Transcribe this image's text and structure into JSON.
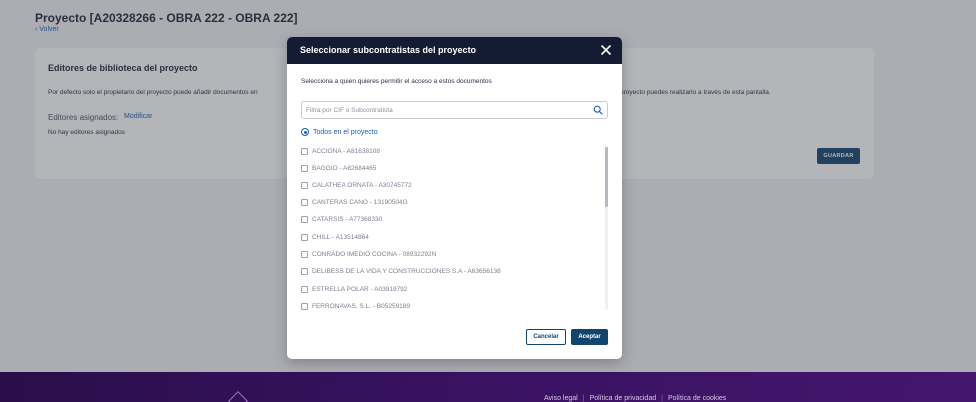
{
  "page": {
    "title": "Proyecto [A20328266 - OBRA 222 - OBRA 222]",
    "back_label": "‹ Volver"
  },
  "card": {
    "title": "Editores de biblioteca del proyecto",
    "description_left": "Por defecto solo el propietario del proyecto puede añadir documentos en",
    "description_right": "proyecto puedes realizarlo a través de esta pantalla.",
    "editors_label": "Editores asignados:",
    "modify_label": "Modificar",
    "empty_text": "No hay editores asignados",
    "save_label": "GUARDAR"
  },
  "modal": {
    "title": "Seleccionar subcontratistas del proyecto",
    "subtitle": "Selecciona a quien quieres permitir el acceso a estos documentos",
    "search_placeholder": "Filtra por CIF o Subcontratista",
    "all_option": "Todos en el proyecto",
    "items": [
      "ACCIONA - A81638108",
      "BAGGIO - A82684465",
      "CALATHEA ORNATA - A30745772",
      "CANTERAS CANO - 13190504G",
      "CATARSIS - A77368330",
      "CHILL - A13514864",
      "CONRADO IMEDIO COCINA - 08932292N",
      "DELIBESS DE LA VIDA Y CONSTRUCCIONES S.A - A63656138",
      "ESTRELLA POLAR - A03919792",
      "FERRONAVAS, S.L. - B05259189"
    ],
    "cancel_label": "Cancelar",
    "accept_label": "Aceptar"
  },
  "footer": {
    "links": [
      "Aviso legal",
      "Política de privacidad",
      "Política de cookies"
    ],
    "separator": "|"
  },
  "colors": {
    "header_dark": "#141c33",
    "primary": "#12456e",
    "link": "#1a5fb4",
    "footer_purple": "#3a1262"
  },
  "icons": {
    "close": "close-icon",
    "search": "search-icon",
    "logo": "brand-logo-icon"
  }
}
